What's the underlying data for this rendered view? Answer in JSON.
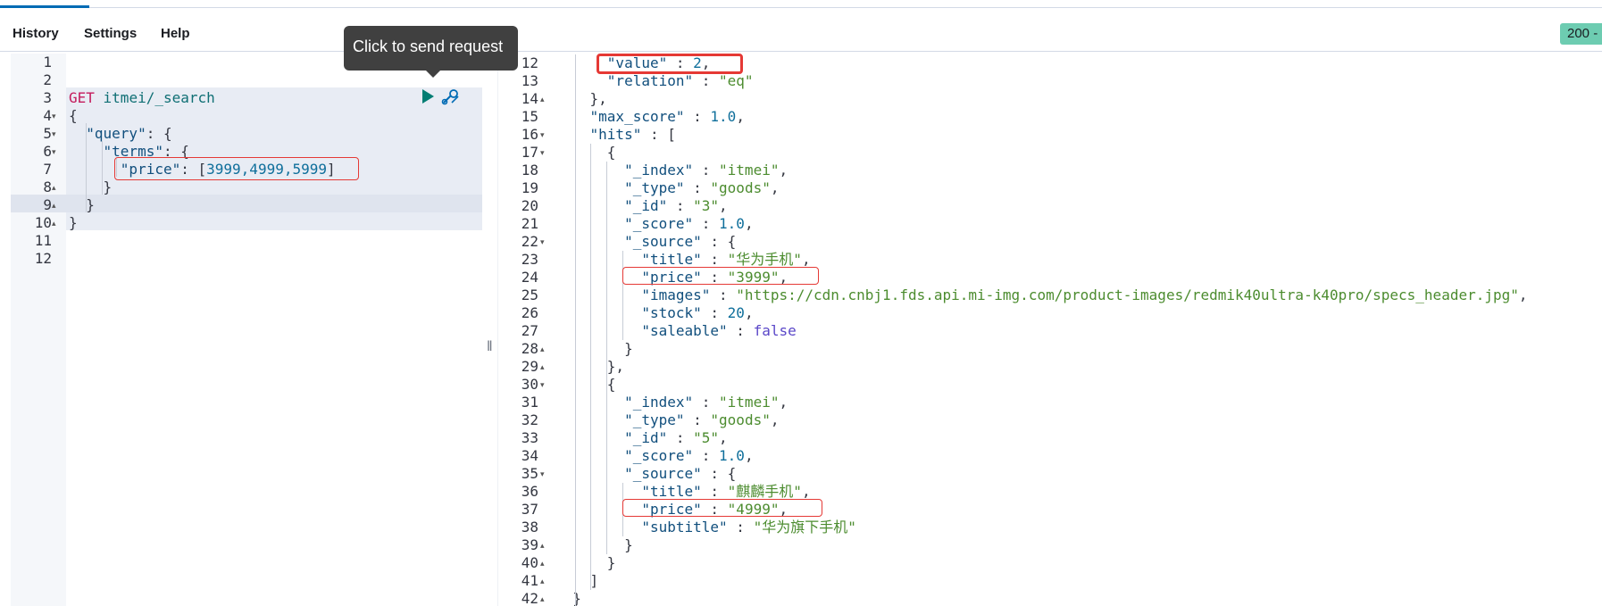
{
  "menu": {
    "history": "History",
    "settings": "Settings",
    "help": "Help"
  },
  "status_badge": "200 -",
  "tooltip": "Click to send request",
  "splitter_glyph": "‖",
  "request": {
    "line_numbers": [
      "1",
      "2",
      "3",
      "4",
      "5",
      "6",
      "7",
      "8",
      "9",
      "10",
      "11",
      "12"
    ],
    "folds": [
      "",
      "",
      "",
      "▾",
      "▾",
      "▾",
      "",
      "▴",
      "▴",
      "▴",
      "",
      ""
    ],
    "method": "GET",
    "path": " itmei/_search",
    "lines": [
      "",
      "",
      "",
      "{",
      "  \"query\": {",
      "    \"terms\": {",
      "      \"price\": [3999,4999,5999]",
      "    }",
      "  }",
      "}",
      "",
      ""
    ]
  },
  "response": {
    "line_numbers": [
      "12",
      "13",
      "14",
      "15",
      "16",
      "17",
      "18",
      "19",
      "20",
      "21",
      "22",
      "23",
      "24",
      "25",
      "26",
      "27",
      "28",
      "29",
      "30",
      "31",
      "32",
      "33",
      "34",
      "35",
      "36",
      "37",
      "38",
      "39",
      "40",
      "41",
      "42"
    ],
    "folds": [
      "",
      "",
      "▴",
      "",
      "▾",
      "▾",
      "",
      "",
      "",
      "",
      "▾",
      "",
      "",
      "",
      "",
      "",
      "▴",
      "▴",
      "▾",
      "",
      "",
      "",
      "",
      "▾",
      "",
      "",
      "",
      "▴",
      "▴",
      "▴",
      "▴"
    ],
    "lines": [
      "      \"value\" : 2,",
      "      \"relation\" : \"eq\"",
      "    },",
      "    \"max_score\" : 1.0,",
      "    \"hits\" : [",
      "      {",
      "        \"_index\" : \"itmei\",",
      "        \"_type\" : \"goods\",",
      "        \"_id\" : \"3\",",
      "        \"_score\" : 1.0,",
      "        \"_source\" : {",
      "          \"title\" : \"华为手机\",",
      "          \"price\" : \"3999\",",
      "          \"images\" : \"https://cdn.cnbj1.fds.api.mi-img.com/product-images/redmik40ultra-k40pro/specs_header.jpg\",",
      "          \"stock\" : 20,",
      "          \"saleable\" : false",
      "        }",
      "      },",
      "      {",
      "        \"_index\" : \"itmei\",",
      "        \"_type\" : \"goods\",",
      "        \"_id\" : \"5\",",
      "        \"_score\" : 1.0,",
      "        \"_source\" : {",
      "          \"title\" : \"麒麟手机\",",
      "          \"price\" : \"4999\",",
      "          \"subtitle\" : \"华为旗下手机\"",
      "        }",
      "      }",
      "    ]",
      "  }"
    ]
  },
  "colors": {
    "accent": "#006bb4",
    "status_ok": "#6dccb1",
    "highlight_box": "#e53935",
    "play": "#017d73"
  }
}
